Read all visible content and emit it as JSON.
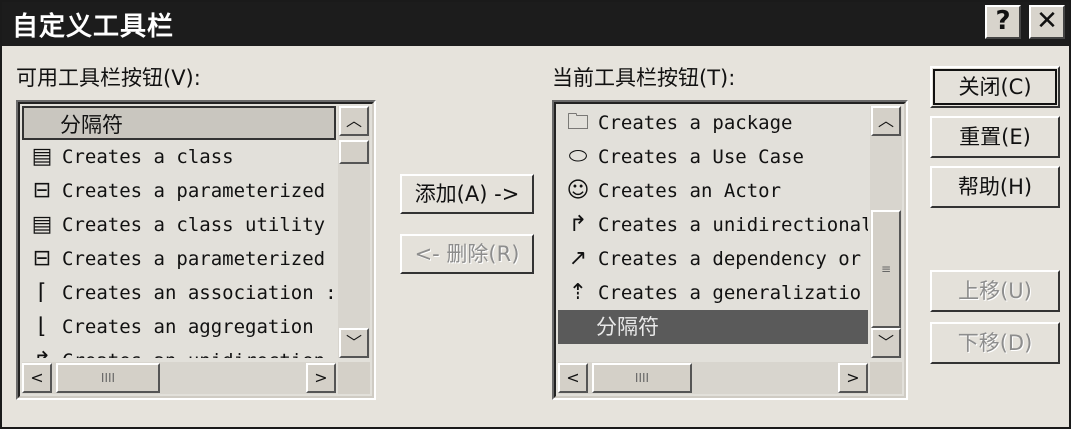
{
  "window": {
    "title": "自定义工具栏",
    "help_glyph": "?",
    "close_glyph": "✕"
  },
  "available": {
    "label": "可用工具栏按钮",
    "hotkey_label": "(V):",
    "items": [
      {
        "label": "分隔符",
        "icon": "separator-icon",
        "glyph": ""
      },
      {
        "label": "Creates a class",
        "icon": "class-icon",
        "glyph": "▤"
      },
      {
        "label": "Creates a parameterized",
        "icon": "parameterized-class-icon",
        "glyph": "⊟"
      },
      {
        "label": "Creates a class utility",
        "icon": "class-utility-icon",
        "glyph": "▤"
      },
      {
        "label": "Creates a parameterized",
        "icon": "parameterized-class-utility-icon",
        "glyph": "⊟"
      },
      {
        "label": "Creates an association :",
        "icon": "association-icon",
        "glyph": "⌈"
      },
      {
        "label": "Creates an aggregation",
        "icon": "aggregation-icon",
        "glyph": "⌊"
      },
      {
        "label": "Creates an unidirection",
        "icon": "unidirectional-icon",
        "glyph": "↱"
      }
    ]
  },
  "current": {
    "label": "当前工具栏按钮",
    "hotkey_label": "(T):",
    "items": [
      {
        "label": "Creates a package",
        "icon": "package-icon",
        "glyph": "🗀"
      },
      {
        "label": "Creates a Use Case",
        "icon": "use-case-icon",
        "glyph": "⬭"
      },
      {
        "label": "Creates an Actor",
        "icon": "actor-icon",
        "glyph": "☺"
      },
      {
        "label": "Creates a unidirectional",
        "icon": "unidirectional-icon",
        "glyph": "↱"
      },
      {
        "label": "Creates a dependency or",
        "icon": "dependency-icon",
        "glyph": "↗"
      },
      {
        "label": "Creates a generalizatio",
        "icon": "generalization-icon",
        "glyph": "⇡"
      },
      {
        "label": "分隔符",
        "icon": "separator-icon",
        "glyph": ""
      }
    ]
  },
  "buttons": {
    "add": "添加(A) ->",
    "remove": "<- 删除(R)",
    "close": "关闭(C)",
    "reset": "重置(E)",
    "help": "帮助(H)",
    "move_up": "上移(U)",
    "move_down": "下移(D)"
  },
  "scroll_glyphs": {
    "up": "︿",
    "down": "﹀",
    "left": "<",
    "right": ">",
    "grip_h": "IIII",
    "grip_v": "≡"
  }
}
